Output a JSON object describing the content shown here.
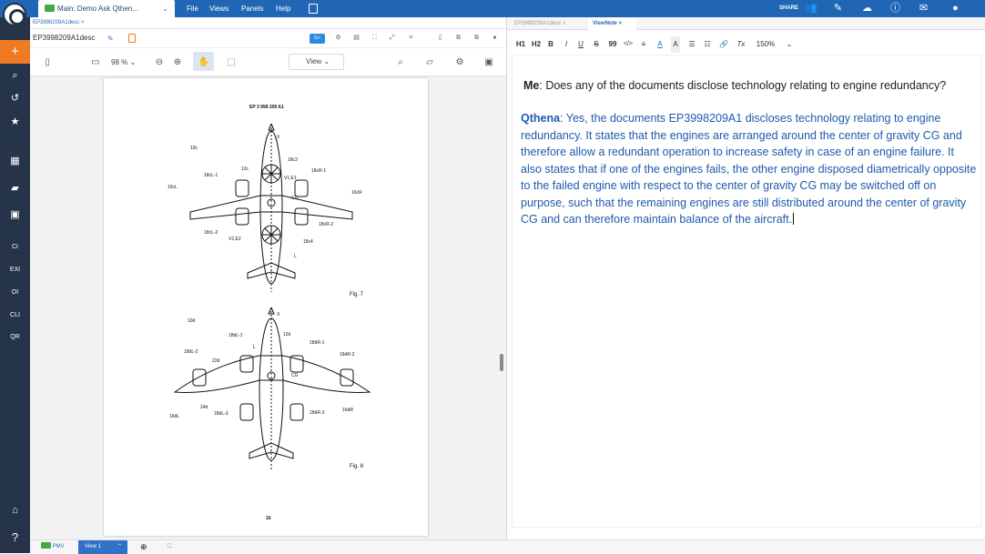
{
  "app": {
    "main_tab": "Main: Demo Ask Qthen...",
    "menu": [
      "File",
      "Views",
      "Panels",
      "Help"
    ],
    "share_label": "SHARE"
  },
  "sidebar": {
    "labels": [
      "CI",
      "EXI",
      "OI",
      "CLI",
      "QR"
    ],
    "bottom_help": "?"
  },
  "document": {
    "tab": "EP3998209A1desc",
    "title": "EP3998209A1desc",
    "zoom": "98 %",
    "view": "View",
    "header": "EP 3 998 209 A1",
    "page_number": "16",
    "blue_button": "G+",
    "fig7": {
      "caption": "Fig. 7",
      "labels": [
        "10c",
        "12c",
        "18c3",
        "18cR-1",
        "18cL-1",
        "V1,E1",
        "16cL",
        "CG",
        "16cR",
        "18cR-2",
        "18cL-2",
        "V2,E2",
        "18c4",
        "L",
        "X"
      ]
    },
    "fig8": {
      "caption": "Fig. 8",
      "labels": [
        "10d",
        "12d",
        "18dL-1",
        "18dR-1",
        "18dL-2",
        "18dR-2",
        "22d",
        "L",
        "CG",
        "24d",
        "16dL",
        "18dL-3",
        "18dR-3",
        "16dR",
        "X"
      ]
    }
  },
  "view_note": {
    "tabs": [
      "EP3998209A1desc",
      "ViewNote"
    ],
    "toolbar": [
      "H1",
      "H2",
      "B",
      "I",
      "U",
      "S",
      "99",
      "</>",
      "≡",
      "A",
      "A",
      "☰",
      "☷",
      "🔗",
      "Tx",
      "150%"
    ],
    "me_label": "Me",
    "me_text": ": Does any of the documents disclose technology relating to engine redundancy?",
    "bot_label": "Qthena",
    "bot_text": ": Yes, the documents EP3998209A1 discloses technology relating to engine redundancy. It states that the engines are arranged around the center of gravity CG and therefore allow a redundant operation to increase safety in case of an engine failure. It also states that if one of the engines fails, the other engine disposed diametrically opposite to the failed engine with respect to the center of gravity CG may be switched off on purpose, such that the remaining engines are still distributed around the center of gravity CG and can therefore maintain balance of the aircraft."
  },
  "bottom": {
    "pmv": "PMV",
    "view": "View 1"
  },
  "colors": {
    "topbar": "#2166b5",
    "sidebar": "#263449",
    "accent": "#f07a23",
    "text_blue": "#1e5aab"
  }
}
